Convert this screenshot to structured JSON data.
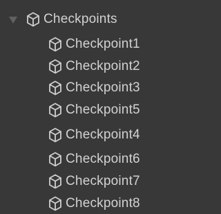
{
  "hierarchy": {
    "parent": {
      "label": "Checkpoints",
      "icon": "gameobject-cube-icon",
      "expanded": true
    },
    "children": [
      {
        "label": "Checkpoint1",
        "icon": "gameobject-cube-icon"
      },
      {
        "label": "Checkpoint2",
        "icon": "gameobject-cube-icon"
      },
      {
        "label": "Checkpoint3",
        "icon": "gameobject-cube-icon"
      },
      {
        "label": "Checkpoint5",
        "icon": "gameobject-cube-icon"
      },
      {
        "label": "Checkpoint4",
        "icon": "gameobject-cube-icon"
      },
      {
        "label": "Checkpoint6",
        "icon": "gameobject-cube-icon"
      },
      {
        "label": "Checkpoint7",
        "icon": "gameobject-cube-icon"
      },
      {
        "label": "Checkpoint8",
        "icon": "gameobject-cube-icon"
      }
    ]
  },
  "colors": {
    "background": "#383838",
    "text": "#d2d2d2",
    "icon": "#cfcfcf",
    "arrow": "#616161"
  }
}
